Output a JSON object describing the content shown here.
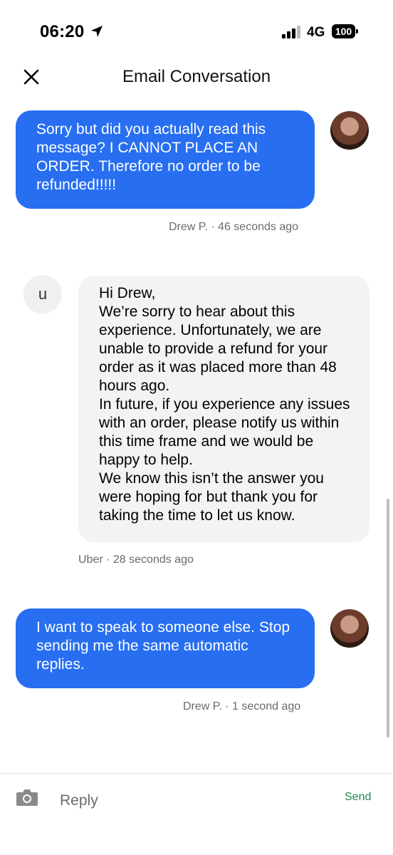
{
  "status": {
    "time": "06:20",
    "network": "4G",
    "battery": "100"
  },
  "header": {
    "title": "Email Conversation"
  },
  "messages": [
    {
      "text": "Sorry but did you actually read this message? I CANNOT PLACE AN ORDER. Therefore no order to be refunded!!!!!",
      "meta": "Drew P. · 46 seconds ago"
    },
    {
      "avatar_letter": "u",
      "text": "Hi      Drew,\nWe’re sorry to hear about this experience. Unfortunately, we are unable to provide a refund for your order as it was placed more than 48 hours ago.\nIn future, if you experience any issues with an order, please notify us within this time frame and we would be happy to help.\nWe know this isn’t the answer you were hoping for but thank you for taking the time to let us know.",
      "meta": "Uber · 28 seconds ago"
    },
    {
      "text": "I want to speak to someone else. Stop sending me the same automatic replies.",
      "meta": "Drew P. · 1 second ago"
    }
  ],
  "composer": {
    "placeholder": "Reply",
    "send_label": "Send"
  },
  "colors": {
    "outgoing_bubble": "#276ef1",
    "incoming_bubble": "#f3f3f3",
    "send": "#1f8a4c"
  }
}
